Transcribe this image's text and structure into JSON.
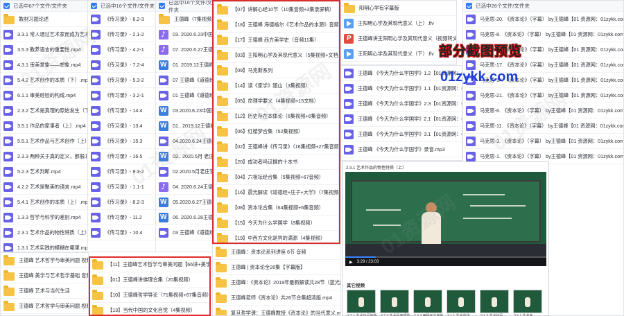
{
  "panel1": {
    "header": "已选中67个文件/文件夹",
    "rows": [
      {
        "icon": "folder",
        "text": "教材习题论述"
      },
      {
        "icon": "video",
        "text": "3.3.1 常人通过艺术家而成为艺术家"
      },
      {
        "icon": "video",
        "text": "3.5.3 教养语言的重要性.mp4"
      },
      {
        "icon": "video",
        "text": "4.3.1 审美意象——想象.mp4"
      },
      {
        "icon": "video",
        "text": "5.4.2 艺术创作的本质（下）.mp4"
      },
      {
        "icon": "video",
        "text": "6.1.1 审美经验的构成.mp4"
      },
      {
        "icon": "video",
        "text": "2.3.2 艺术是真理的原始发生（下）"
      },
      {
        "icon": "video",
        "text": "3.5.1 作品的家事者（上）.mp4"
      },
      {
        "icon": "video",
        "text": "5.5.1 艺术作品与艺术创作（上）"
      },
      {
        "icon": "video",
        "text": "2.3.3 两种关于真的定义，那般北斋"
      },
      {
        "icon": "video",
        "text": "5.2.3 艺术判断.mp4"
      },
      {
        "icon": "video",
        "text": "4.2.2 艺术是聚美的语言.mp4"
      },
      {
        "icon": "video",
        "text": "5.4.1 艺术创作的本质（上）.mp4"
      },
      {
        "icon": "video",
        "text": "1.3.3 哲学与科学的差别.mp4"
      },
      {
        "icon": "video",
        "text": "2.3.1 艺术作品的物性特质（上）"
      },
      {
        "icon": "video",
        "text": "1.3.1 艺术实践的模糊在哪里.mp4"
      }
    ]
  },
  "panel2": {
    "header": "已选中16个文件/文件夹",
    "rows": [
      {
        "icon": "video",
        "text": "《传习录》- 6.2-3"
      },
      {
        "icon": "video",
        "text": "《传习录》- 2.1-2"
      },
      {
        "icon": "video",
        "text": "《传习录》- 4.2-1"
      },
      {
        "icon": "video",
        "text": "《传习录》- 7.2-4"
      },
      {
        "icon": "video",
        "text": "《传习录》- 5.3-2"
      },
      {
        "icon": "video",
        "text": "《传习录》- 3.2-1"
      },
      {
        "icon": "video",
        "text": "《传习录》- 14.4"
      },
      {
        "icon": "video",
        "text": "《传习录》- 13.4"
      },
      {
        "icon": "video",
        "text": "《传习录》- 15.3"
      },
      {
        "icon": "video",
        "text": "《传习录》- 16.5"
      },
      {
        "icon": "video",
        "text": "《传习录》- 9.3-2"
      },
      {
        "icon": "video",
        "text": "《传习录》- 1.1-1"
      },
      {
        "icon": "video",
        "text": "《传习录》- 8.2-3"
      },
      {
        "icon": "video",
        "text": "《传习录》- 11.2"
      },
      {
        "icon": "video",
        "text": "《传习录》- 10.4"
      }
    ]
  },
  "panel3": {
    "header": "已选中16个文件/文件夹",
    "rows": [
      {
        "icon": "folder",
        "text": "王德峰（7集视频）"
      },
      {
        "icon": "audio",
        "text": "03. 2020.6.23中国哲"
      },
      {
        "icon": "audio",
        "text": "07. 2020.6.27王德峰"
      },
      {
        "icon": "word",
        "text": "01. 2019.12王德峰"
      },
      {
        "icon": "video",
        "text": "07 王德峰《道德经》"
      },
      {
        "icon": "video",
        "text": "01 王德峰《道德经》"
      },
      {
        "icon": "word",
        "text": "03.2020.6.23中国哲学"
      },
      {
        "icon": "word",
        "text": "01.. 2019.12王德峰 我"
      },
      {
        "icon": "video",
        "text": "04.2020.6.24王德峰"
      },
      {
        "icon": "word",
        "text": "02.. 2020.5月 老庄"
      },
      {
        "icon": "video",
        "text": "02.2020.5月老庄哲学"
      },
      {
        "icon": "audio",
        "text": "04. 2020.6.24王德峰"
      },
      {
        "icon": "word",
        "text": "05.2020.6.27王德峰"
      },
      {
        "icon": "word",
        "text": "06. 2020.6.28王德峰"
      },
      {
        "icon": "video",
        "text": "03 王德峰《道德经》"
      }
    ]
  },
  "panel4": {
    "rows": [
      {
        "icon": "folder",
        "text": "【07】讲解心经10节（10集音频+3集录屏稿）"
      },
      {
        "icon": "folder",
        "text": "【18】王德峰 海德格尔《艺术作品的本源》音频4集"
      },
      {
        "icon": "folder",
        "text": "【17】王德峰 西方美学史（音频11集）"
      },
      {
        "icon": "folder",
        "text": "【03】王阳明心学及其现代意义（5集视频+文档）"
      },
      {
        "icon": "folder",
        "text": "【09】马克斯系列"
      },
      {
        "icon": "folder",
        "text": "【14】读《家学》随山（3集视频）"
      },
      {
        "icon": "folder",
        "text": "【05】命理学要义（4集视频+15文档）"
      },
      {
        "icon": "folder",
        "text": "【12】历史存在本体论（6集视频+6集音频）"
      },
      {
        "icon": "folder",
        "text": "【06】红楼梦合集（52集视频）"
      },
      {
        "icon": "folder",
        "text": "【02】王德峰讲《传习录》（16集视频+27集音频）"
      },
      {
        "icon": "folder",
        "text": "【20】成功者吗证据的十本书"
      },
      {
        "icon": "folder",
        "text": "【04】六祖坛经合集（5集视频+67音频）"
      },
      {
        "icon": "folder",
        "text": "【16】晨光解读《道德经+庄子+大学》（7集视频+9集音频）"
      },
      {
        "icon": "folder",
        "text": "【08】资本论合集（64集视频+6集音频）"
      },
      {
        "icon": "folder",
        "text": "【15】今天为什么学国学（8集视频）"
      },
      {
        "icon": "folder",
        "text": "【19】中西方文化是异的满源（4集视频）"
      }
    ]
  },
  "panel5": {
    "rows": [
      {
        "icon": "folder",
        "text": "王德峰 艺术哲学与审美问题 视频66讲"
      },
      {
        "icon": "folder",
        "text": "王德峰 美学与艺术哲学基础 音频"
      },
      {
        "icon": "folder",
        "text": "王德峰 艺术与当代生活"
      },
      {
        "icon": "folder",
        "text": "王德峰 艺术哲学与审美问题 视频66讲"
      }
    ],
    "first_row": "王德峰 艺术与当代世界"
  },
  "panel6": {
    "rows": [
      {
        "icon": "folder",
        "text": "【11】王德峰艺术哲学与审美问题【66讲+美学类】"
      },
      {
        "icon": "folder",
        "text": "【01】王德峰讲佛理合集（20集视频）"
      },
      {
        "icon": "folder",
        "text": "【10】王德峰哲学导论（71集视频+67集音频）"
      },
      {
        "icon": "folder",
        "text": "【13】当代中国的文化自觉（4集视频）"
      }
    ]
  },
  "panel7": {
    "rows": [
      {
        "icon": "folder",
        "text": "王德峰：资本论系列讲座 6节 音频"
      },
      {
        "icon": "folder",
        "text": "王德峰 | 资本论全26集【字幕版】"
      },
      {
        "icon": "folder",
        "text": "王德峰：《资本论》2019年最新解读共28节（蓝光版）"
      },
      {
        "icon": "folder",
        "text": "王德峰老师《资本论》共26节合集超清版.mp4"
      },
      {
        "icon": "folder",
        "text": "复旦哲学课：王德峰教授《资本论》的当代意义.mp4"
      }
    ]
  },
  "panel8": {
    "rows": [
      {
        "icon": "folder",
        "text": "阳明心学有字幕版"
      },
      {
        "icon": "flv",
        "text": "王阳明心学及其现代意义（上）.flv"
      },
      {
        "icon": "pdf",
        "text": "王德峰讲王阳明心学及其现代意义（视频转文字）.docx"
      },
      {
        "icon": "flv",
        "text": "王阳明心学及其现代意义（下）.flv"
      }
    ]
  },
  "panel9": {
    "rows": [
      {
        "icon": "video",
        "text": "王德峰 《今天为什么学国学》1.2【01资源网：01zykk.com"
      },
      {
        "icon": "video",
        "text": "王德峰 《今天为什么学国学》1.1【01资源网：01zykk.com"
      },
      {
        "icon": "video",
        "text": "王德峰 《今天为什么学国学》2.3【01资源网：01zykk.com"
      },
      {
        "icon": "video",
        "text": "王德峰 《今天为什么学国学》2.1【01资源网：01zykk.com"
      },
      {
        "icon": "video",
        "text": "王德峰 《今天为什么学国学》3.1【01资源网：01zykk.com"
      },
      {
        "icon": "video",
        "text": "王德峰 《今天为什么学国学》录音.mp3"
      }
    ]
  },
  "panel10": {
    "header": "已选中26个文件/文件夹",
    "rows": [
      {
        "icon": "video",
        "text": "马克思-20. 《资本论》（字幕） by王德峰【01 资源网：01zykk.com】.mp4"
      },
      {
        "icon": "video",
        "text": "马克思-8. 《资本论》（字幕） by王德峰【01 资源网：01zykk.com】.mp4"
      },
      {
        "icon": "video",
        "text": "马克思-15. 《资本论》（字幕） by王德峰【01 资源网：01zykk.com】.mp4"
      },
      {
        "icon": "video",
        "text": "马克思-17. 《资本论》（字幕） by王德峰【01 资源网：01zykk.com】.mp4"
      },
      {
        "icon": "video",
        "text": "马克思-14. 《资本论》（字幕） by王德峰【01 资源网：01zykk.com】.mp4"
      },
      {
        "icon": "video",
        "text": "马克思-21. 《资本论》（字幕） by王德峰【01 资源网：01zykk.com】.mp4"
      },
      {
        "icon": "video",
        "text": "马克思-6. 《资本论》（字幕） by王德峰【01 资源网：01zykk.com】.mp4"
      },
      {
        "icon": "video",
        "text": "马克思-11. 《资本论》（字幕） by王德峰【01 资源网：01zykk.com】.mp4"
      },
      {
        "icon": "video",
        "text": "马克思-3. 《资本论》（字幕） by王德峰【01 资源网：01zykk.com】.mp4"
      },
      {
        "icon": "video",
        "text": "马克思-1. 《资本论》（字幕） by王德峰【01 资源网：01zykk.com】.mp4"
      }
    ]
  },
  "video": {
    "title": "2.3.1 艺术作品的物性特质（上）",
    "time": "3:29 / 23:03",
    "progress": 0.15,
    "related_label": "其它视频",
    "thumbs": [
      "2.3.1 艺术作品的物性",
      "2.3.2 艺术是真理的",
      "2.3.3 两种关于真的",
      "3.1.1 艺术创作",
      "3.1.2 艺术作品",
      "3.2.1 艺术家"
    ]
  },
  "promo": {
    "preview": "部分截图预览",
    "site": "01zykk.com"
  },
  "watermark": "01资源网",
  "colors": {
    "accent": "#2f7cf6",
    "highlight": "#e02b2b",
    "promo_blue": "#1d3fd6"
  }
}
